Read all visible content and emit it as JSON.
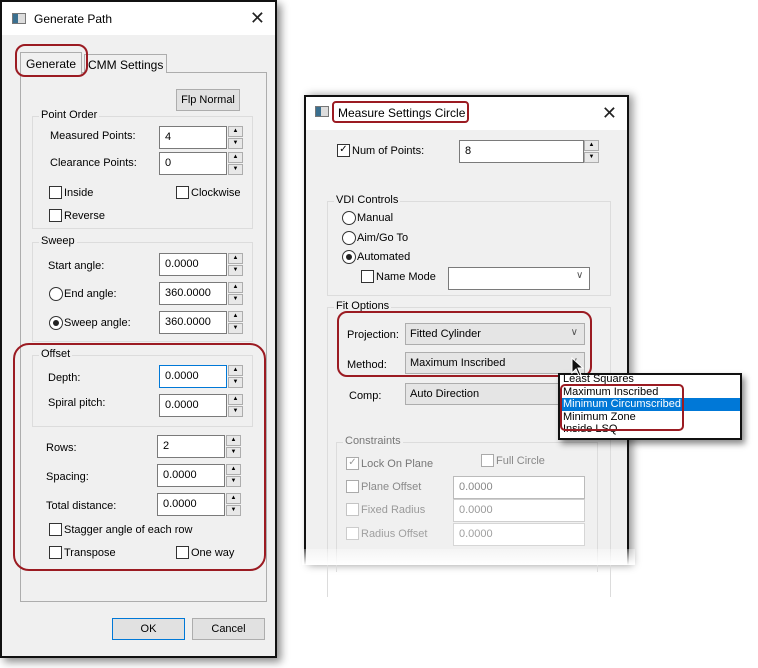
{
  "left": {
    "title": "Generate Path",
    "tabs": [
      "Generate",
      "CMM Settings"
    ],
    "flip_button": "Flp Normal",
    "point_order": {
      "label": "Point Order",
      "measured_label": "Measured Points:",
      "measured": "4",
      "clearance_label": "Clearance Points:",
      "clearance": "0",
      "inside": "Inside",
      "clockwise": "Clockwise",
      "reverse": "Reverse"
    },
    "sweep": {
      "label": "Sweep",
      "start_label": "Start angle:",
      "start": "0.0000",
      "end_label": "End angle:",
      "end": "360.0000",
      "sweep_label": "Sweep angle:",
      "sweep": "360.0000",
      "selected": "Sweep angle"
    },
    "offset": {
      "label": "Offset",
      "depth_label": "Depth:",
      "depth": "0.0000",
      "spiral_label": "Spiral pitch:",
      "spiral": "0.0000"
    },
    "rows_label": "Rows:",
    "rows": "2",
    "spacing_label": "Spacing:",
    "spacing": "0.0000",
    "total_label": "Total distance:",
    "total": "0.0000",
    "stagger": "Stagger angle of each row",
    "transpose": "Transpose",
    "oneway": "One way",
    "ok": "OK",
    "cancel": "Cancel"
  },
  "right": {
    "title": "Measure Settings Circle",
    "num_points_label": "Num of Points:",
    "num_points": "8",
    "num_points_checked": true,
    "vdi": {
      "label": "VDI Controls",
      "manual": "Manual",
      "aim": "Aim/Go To",
      "automated": "Automated",
      "selected": "Automated",
      "name_mode": "Name Mode",
      "name_mode_value": ""
    },
    "fit": {
      "label": "Fit Options",
      "projection_label": "Projection:",
      "projection": "Fitted Cylinder",
      "method_label": "Method:",
      "method": "Maximum Inscribed",
      "comp_label": "Comp:",
      "comp": "Auto Direction"
    },
    "dropdown": {
      "options": [
        "Least Squares",
        "Maximum Inscribed",
        "Minimum Circumscribed",
        "Minimum Zone",
        "Inside LSQ"
      ],
      "highlighted": "Minimum Circumscribed"
    },
    "constraints": {
      "label": "Constraints",
      "lock": "Lock On Plane",
      "lock_checked": true,
      "full": "Full Circle",
      "plane": "Plane Offset",
      "plane_value": "0.0000",
      "fixed": "Fixed Radius",
      "fixed_value": "0.0000",
      "radius": "Radius Offset",
      "radius_value": "0.0000"
    }
  },
  "colors": {
    "highlight": "#9b1b22",
    "selection": "#0078d7"
  }
}
